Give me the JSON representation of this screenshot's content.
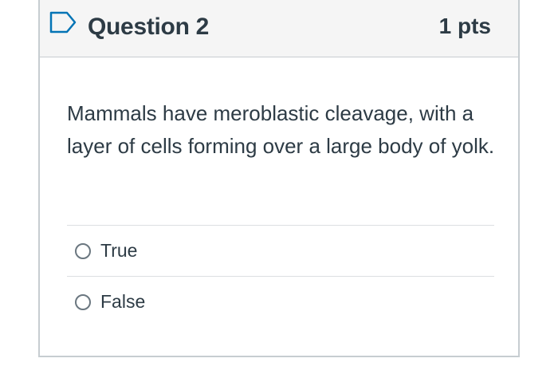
{
  "question": {
    "title": "Question 2",
    "points": "1 pts",
    "flag_icon": "bookmark-flag-icon",
    "text": "Mammals have meroblastic cleavage, with a layer of cells forming over a large body of yolk.",
    "answers": [
      {
        "label": "True",
        "selected": false
      },
      {
        "label": "False",
        "selected": false
      }
    ]
  },
  "colors": {
    "header_bg": "#f5f5f5",
    "border": "#c7cdd1",
    "text": "#2d3b45",
    "flag": "#0374b5"
  }
}
